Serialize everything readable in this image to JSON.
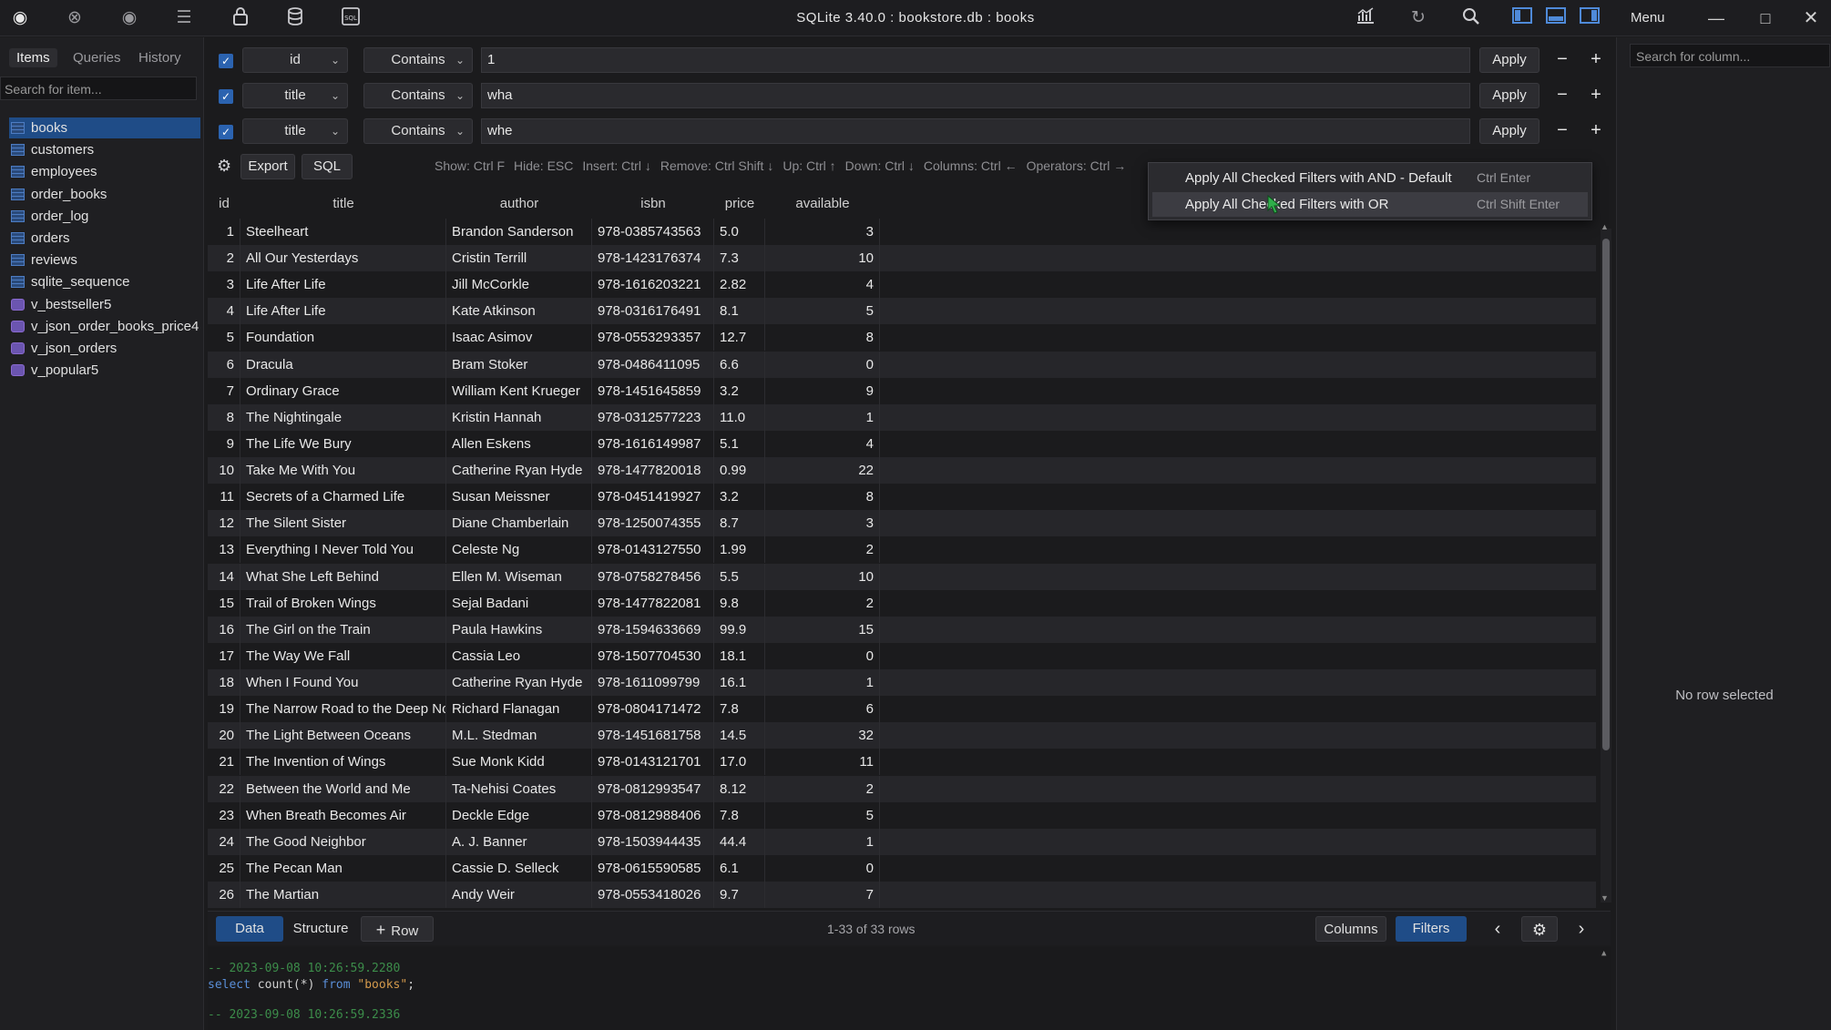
{
  "titlebar": {
    "title": "SQLite 3.40.0 : bookstore.db : books",
    "menu_label": "Menu",
    "left_icons": [
      "logo-icon",
      "close-circle-icon",
      "eye-icon",
      "list-icon",
      "lock-icon",
      "database-icon",
      "sql-file-icon"
    ],
    "right_icons": [
      "chart-icon",
      "refresh-icon",
      "search-icon",
      "panel-left-icon",
      "panel-bottom-icon",
      "panel-right-icon"
    ]
  },
  "sidebar": {
    "tabs": [
      "Items",
      "Queries",
      "History"
    ],
    "search_placeholder": "Search for item...",
    "items": [
      {
        "label": "books",
        "type": "table",
        "selected": true
      },
      {
        "label": "customers",
        "type": "table"
      },
      {
        "label": "employees",
        "type": "table"
      },
      {
        "label": "order_books",
        "type": "table"
      },
      {
        "label": "order_log",
        "type": "table"
      },
      {
        "label": "orders",
        "type": "table"
      },
      {
        "label": "reviews",
        "type": "table"
      },
      {
        "label": "sqlite_sequence",
        "type": "table"
      },
      {
        "label": "v_bestseller5",
        "type": "view"
      },
      {
        "label": "v_json_order_books_price4",
        "type": "view"
      },
      {
        "label": "v_json_orders",
        "type": "view"
      },
      {
        "label": "v_popular5",
        "type": "view"
      }
    ]
  },
  "filters": [
    {
      "checked": true,
      "column": "id",
      "operator": "Contains",
      "value": "1",
      "apply": "Apply"
    },
    {
      "checked": true,
      "column": "title",
      "operator": "Contains",
      "value": "wha",
      "apply": "Apply"
    },
    {
      "checked": true,
      "column": "title",
      "operator": "Contains",
      "value": "whe",
      "apply": "Apply"
    }
  ],
  "toolbar": {
    "export_label": "Export",
    "sql_label": "SQL",
    "shortcuts": [
      "Show: Ctrl F",
      "Hide: ESC",
      "Insert: Ctrl ↓",
      "Remove: Ctrl Shift ↓",
      "Up: Ctrl ↑",
      "Down: Ctrl ↓",
      "Columns: Ctrl ←",
      "Operators: Ctrl →"
    ]
  },
  "context_menu": [
    {
      "label": "Apply All Checked Filters with AND - Default",
      "shortcut": "Ctrl Enter",
      "highlighted": false
    },
    {
      "label": "Apply All Checked Filters with OR",
      "shortcut": "Ctrl Shift Enter",
      "highlighted": true
    }
  ],
  "grid": {
    "columns": [
      "id",
      "title",
      "author",
      "isbn",
      "price",
      "available"
    ],
    "rows": [
      [
        "1",
        "Steelheart",
        "Brandon Sanderson",
        "978-0385743563",
        "5.0",
        "3"
      ],
      [
        "2",
        "All Our Yesterdays",
        "Cristin Terrill",
        "978-1423176374",
        "7.3",
        "10"
      ],
      [
        "3",
        "Life After Life",
        "Jill McCorkle",
        "978-1616203221",
        "2.82",
        "4"
      ],
      [
        "4",
        "Life After Life",
        "Kate Atkinson",
        "978-0316176491",
        "8.1",
        "5"
      ],
      [
        "5",
        "Foundation",
        "Isaac Asimov",
        "978-0553293357",
        "12.7",
        "8"
      ],
      [
        "6",
        "Dracula",
        "Bram Stoker",
        "978-0486411095",
        "6.6",
        "0"
      ],
      [
        "7",
        "Ordinary Grace",
        "William Kent Krueger",
        "978-1451645859",
        "3.2",
        "9"
      ],
      [
        "8",
        "The Nightingale",
        "Kristin Hannah",
        "978-0312577223",
        "11.0",
        "1"
      ],
      [
        "9",
        "The Life We Bury",
        "Allen Eskens",
        "978-1616149987",
        "5.1",
        "4"
      ],
      [
        "10",
        "Take Me With You",
        "Catherine Ryan Hyde",
        "978-1477820018",
        "0.99",
        "22"
      ],
      [
        "11",
        "Secrets of a Charmed Life",
        "Susan Meissner",
        "978-0451419927",
        "3.2",
        "8"
      ],
      [
        "12",
        "The Silent Sister",
        "Diane Chamberlain",
        "978-1250074355",
        "8.7",
        "3"
      ],
      [
        "13",
        "Everything I Never Told You",
        "Celeste Ng",
        "978-0143127550",
        "1.99",
        "2"
      ],
      [
        "14",
        "What She Left Behind",
        "Ellen M. Wiseman",
        "978-0758278456",
        "5.5",
        "10"
      ],
      [
        "15",
        "Trail of Broken Wings",
        "Sejal Badani",
        "978-1477822081",
        "9.8",
        "2"
      ],
      [
        "16",
        "The Girl on the Train",
        "Paula Hawkins",
        "978-1594633669",
        "99.9",
        "15"
      ],
      [
        "17",
        "The Way We Fall",
        "Cassia Leo",
        "978-1507704530",
        "18.1",
        "0"
      ],
      [
        "18",
        "When I Found You",
        "Catherine Ryan Hyde",
        "978-1611099799",
        "16.1",
        "1"
      ],
      [
        "19",
        "The Narrow Road to the Deep North",
        "Richard Flanagan",
        "978-0804171472",
        "7.8",
        "6"
      ],
      [
        "20",
        "The Light Between Oceans",
        "M.L. Stedman",
        "978-1451681758",
        "14.5",
        "32"
      ],
      [
        "21",
        "The Invention of Wings",
        "Sue Monk Kidd",
        "978-0143121701",
        "17.0",
        "11"
      ],
      [
        "22",
        "Between the World and Me",
        "Ta-Nehisi Coates",
        "978-0812993547",
        "8.12",
        "2"
      ],
      [
        "23",
        "When Breath Becomes Air",
        "Deckle Edge",
        "978-0812988406",
        "7.8",
        "5"
      ],
      [
        "24",
        "The Good Neighbor",
        "A. J. Banner",
        "978-1503944435",
        "44.4",
        "1"
      ],
      [
        "25",
        "The Pecan Man",
        "Cassie D. Selleck",
        "978-0615590585",
        "6.1",
        "0"
      ],
      [
        "26",
        "The Martian",
        "Andy Weir",
        "978-0553418026",
        "9.7",
        "7"
      ]
    ]
  },
  "bottombar": {
    "data_tab": "Data",
    "structure_tab": "Structure",
    "add_row": "Row",
    "row_count": "1-33 of 33 rows",
    "columns_btn": "Columns",
    "filters_btn": "Filters"
  },
  "log": {
    "lines": [
      {
        "text": "-- 2023-09-08 10:26:59.2280",
        "kind": "comment"
      },
      {
        "kw1": "select",
        "mid": " count(*) ",
        "kw2": "from",
        "str": " \"books\"",
        "end": ";",
        "kind": "sql"
      },
      {
        "text": "-- 2023-09-08 10:26:59.2336",
        "kind": "comment"
      }
    ]
  },
  "right_panel": {
    "search_placeholder": "Search for column...",
    "no_row_text": "No row selected"
  },
  "colors": {
    "accent": "#1f4c87",
    "checkbox": "#2b63b0",
    "comment": "#3c8c4a",
    "keyword": "#5a8fd8",
    "string": "#d49a4c"
  }
}
